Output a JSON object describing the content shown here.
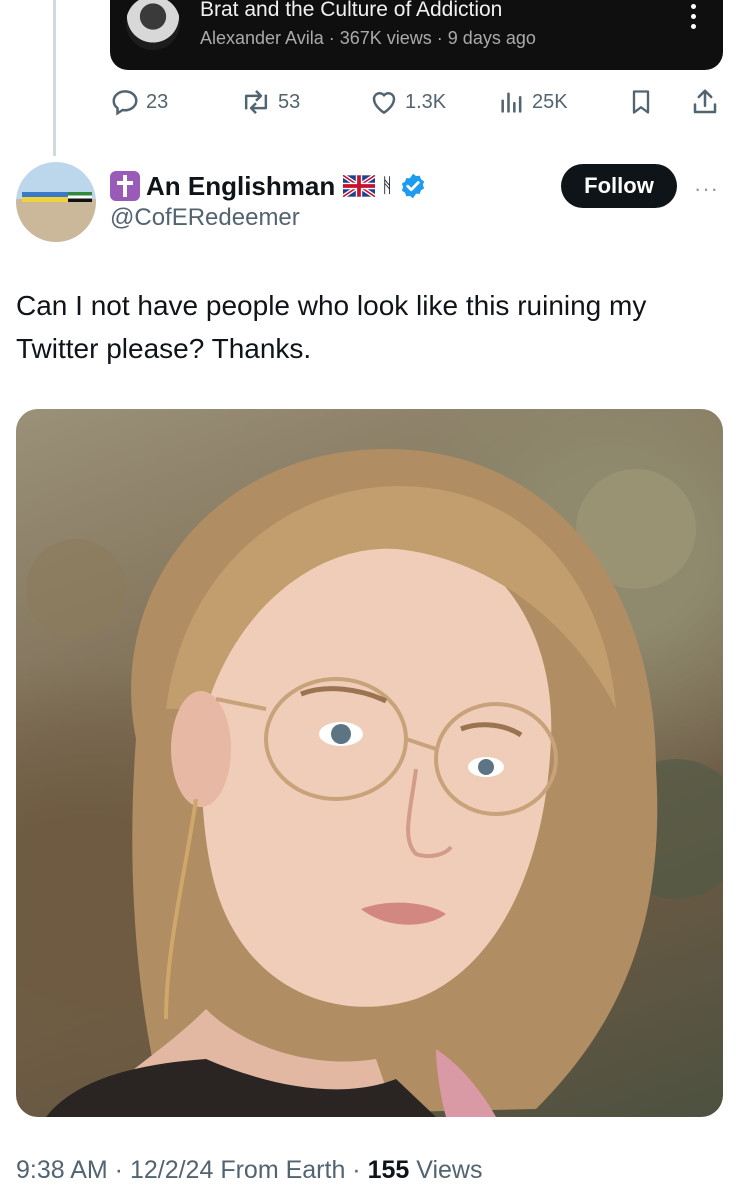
{
  "embedded_video": {
    "title": "Brat and the Culture of Addiction",
    "meta": "Alexander Avila · 367K views · 9 days ago"
  },
  "parent_actions": {
    "replies": "23",
    "reposts": "53",
    "likes": "1.3K",
    "views": "25K"
  },
  "tweet": {
    "display_name": "An Englishman",
    "handle": "@CofERedeemer",
    "follow_label": "Follow",
    "text": "Can I not have people who look like this ruining my Twitter please? Thanks.",
    "time": "9:38 AM",
    "date": "12/2/24",
    "source": "From Earth",
    "view_count": "155",
    "views_label": "Views"
  },
  "colors": {
    "accent_dark": "#0f1419",
    "secondary_text": "#536471",
    "verified_blue": "#1d9bf0",
    "cross_badge": "#9a5ab8"
  },
  "icons": {
    "reply": "reply-icon",
    "repost": "repost-icon",
    "like": "heart-icon",
    "views": "analytics-icon",
    "bookmark": "bookmark-icon",
    "share": "share-icon",
    "verified": "verified-badge-icon",
    "union_flag": "union-flag-icon"
  }
}
